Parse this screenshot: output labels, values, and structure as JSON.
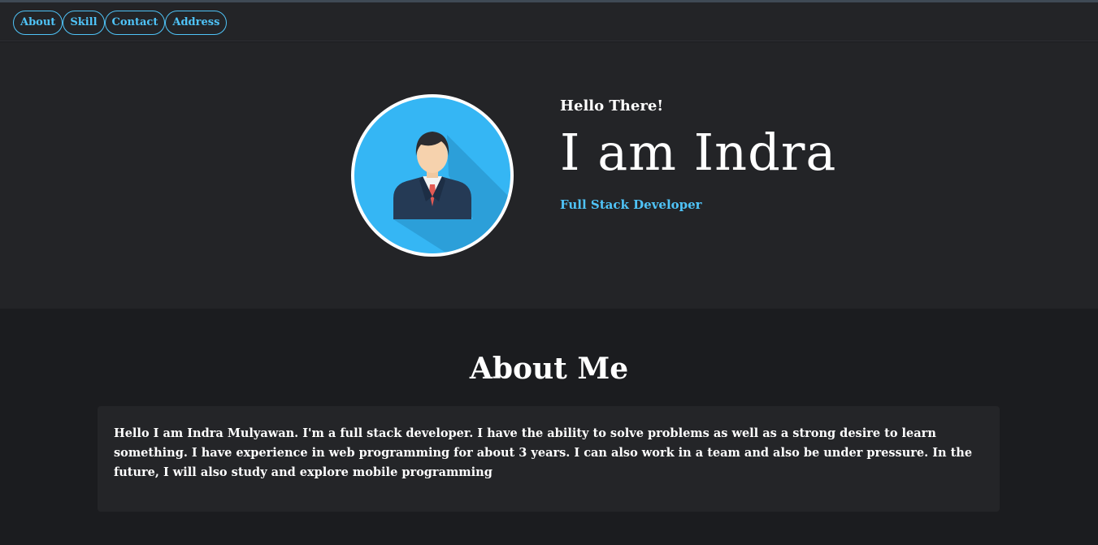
{
  "nav": {
    "items": [
      {
        "label": "About"
      },
      {
        "label": "Skill"
      },
      {
        "label": "Contact"
      },
      {
        "label": "Address"
      }
    ]
  },
  "hero": {
    "greeting": "Hello There!",
    "name": "I am Indra",
    "role": "Full Stack Developer",
    "avatar_icon": "person-avatar-icon"
  },
  "about": {
    "title": "About Me",
    "text": "Hello I am Indra Mulyawan. I'm a full stack developer. I have the ability to solve problems as well as a strong desire to learn something. I have experience in web programming for about 3 years. I can also work in a team and also be under pressure. In the future, I will also study and explore mobile programming"
  },
  "colors": {
    "accent": "#4fc3f7",
    "hero_bg": "#232427",
    "page_bg": "#1b1c1f",
    "avatar_bg": "#35b6f4"
  }
}
